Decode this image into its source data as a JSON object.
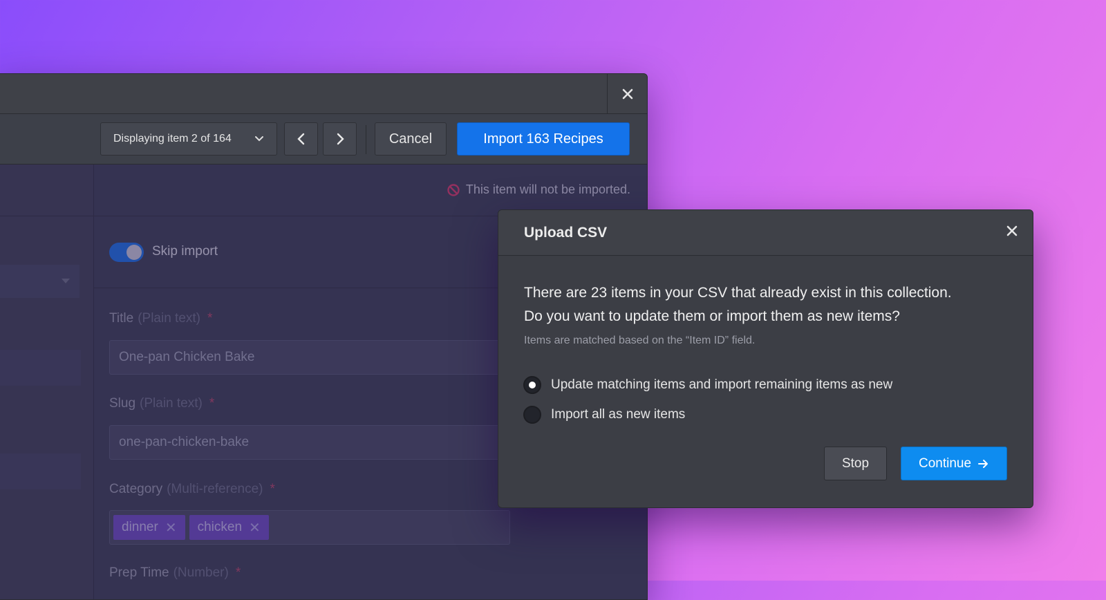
{
  "toolbar": {
    "display_label": "Displaying item 2 of 164",
    "cancel_label": "Cancel",
    "import_label": "Import 163 Recipes"
  },
  "notice": {
    "text": "This item will not be imported."
  },
  "skip": {
    "label": "Skip import",
    "enabled": true
  },
  "fields": {
    "title": {
      "label": "Title",
      "hint": "(Plain text)",
      "required": "*",
      "value": "One-pan Chicken Bake"
    },
    "slug": {
      "label": "Slug",
      "hint": "(Plain text)",
      "required": "*",
      "value": "one-pan-chicken-bake"
    },
    "category": {
      "label": "Category",
      "hint": "(Multi-reference)",
      "required": "*",
      "tags": [
        "dinner",
        "chicken"
      ]
    },
    "prep_time": {
      "label": "Prep Time",
      "hint": "(Number)",
      "required": "*"
    }
  },
  "modal": {
    "title": "Upload CSV",
    "question_line1": "There are 23 items in your CSV that already exist in this collection.",
    "question_line2": "Do you want to update them or import them as new items?",
    "hint": "Items are matched based on the “Item ID” field.",
    "options": [
      {
        "label": "Update matching items and import remaining items as new",
        "selected": true
      },
      {
        "label": "Import all as new items",
        "selected": false
      }
    ],
    "stop_label": "Stop",
    "continue_label": "Continue"
  },
  "colors": {
    "primary": "#1473ea",
    "continue": "#0e8cf0",
    "tag": "#6f4ac2",
    "required": "#c2455d",
    "error_icon": "#e5385f"
  },
  "icons": [
    "close-icon",
    "chevron-down-icon",
    "chevron-left-icon",
    "chevron-right-icon",
    "no-entry-icon",
    "arrow-right-icon",
    "triangle-down-icon"
  ]
}
